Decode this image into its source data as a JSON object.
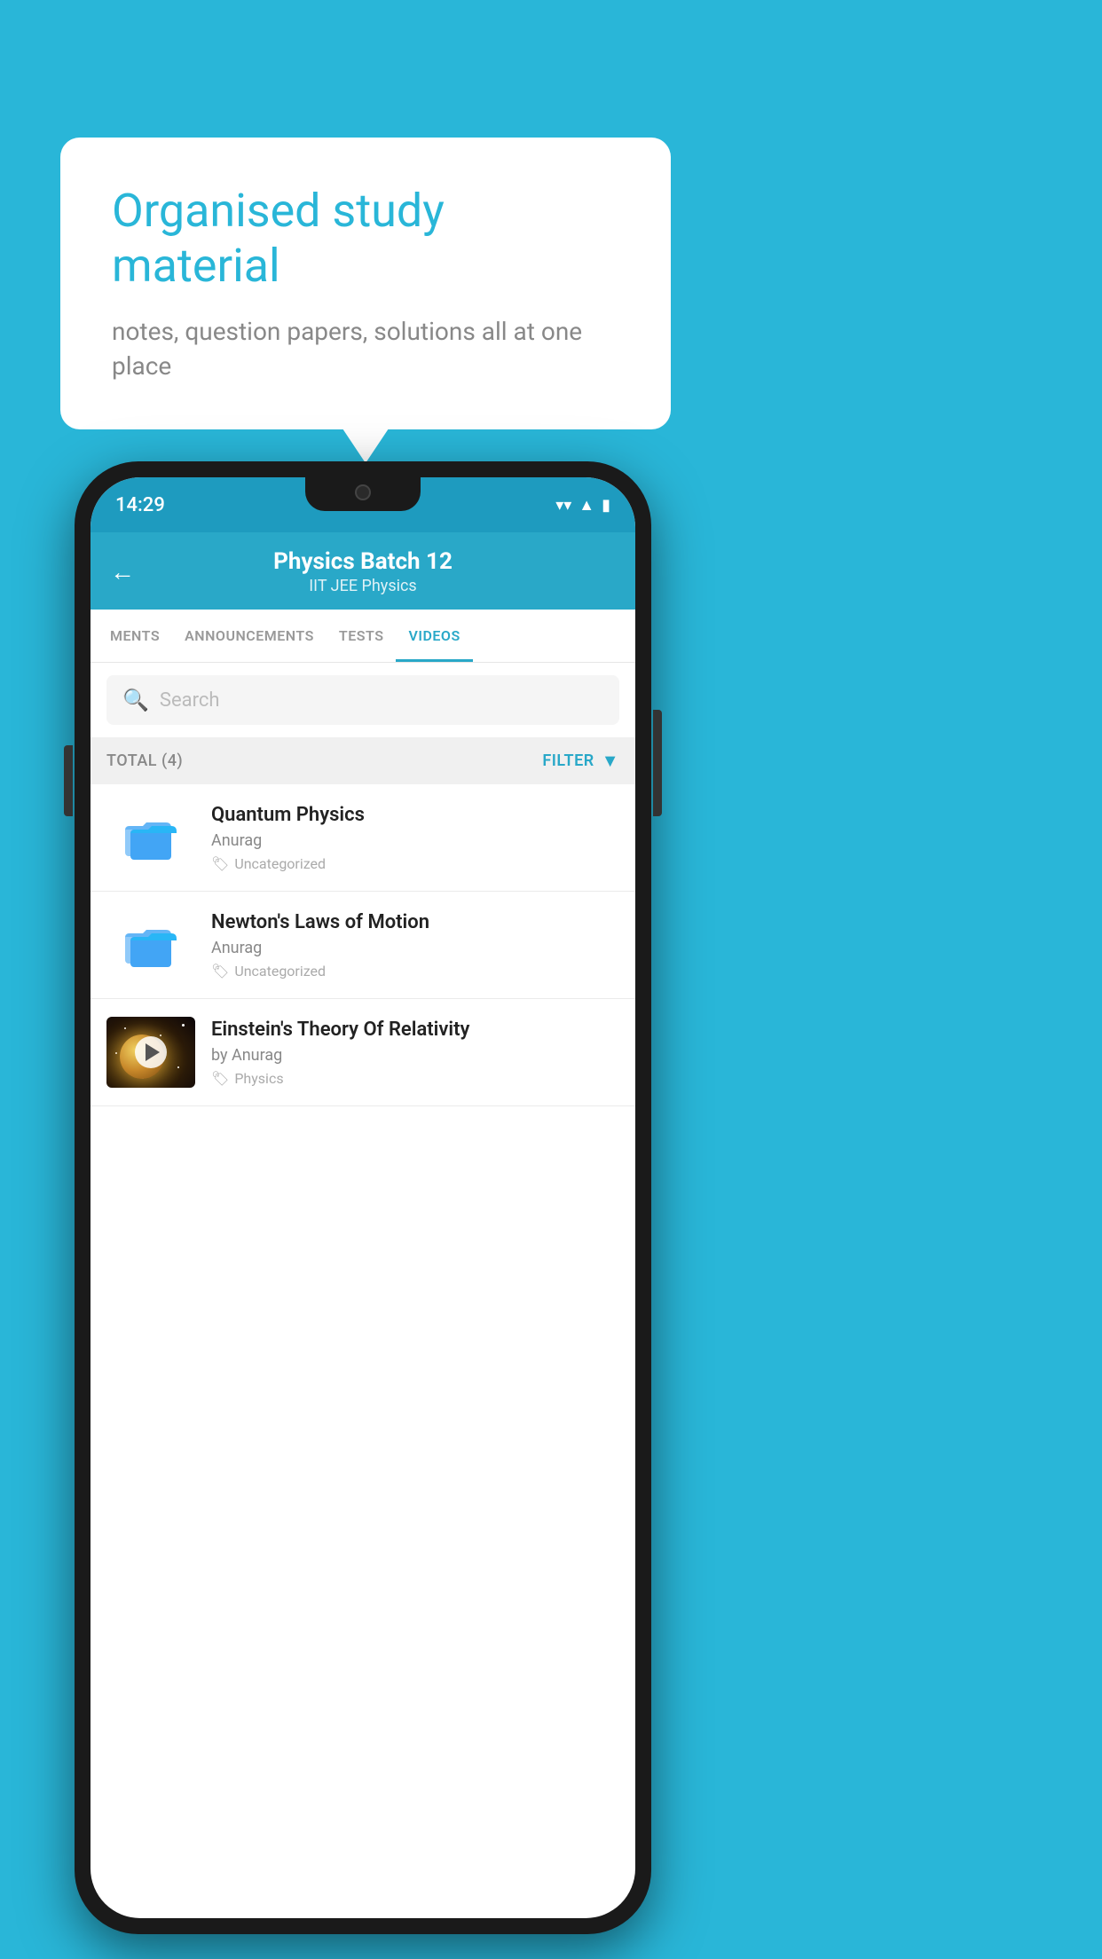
{
  "background_color": "#29b6d8",
  "speech_bubble": {
    "title": "Organised study material",
    "subtitle": "notes, question papers, solutions all at one place"
  },
  "status_bar": {
    "time": "14:29",
    "wifi_icon": "wifi",
    "signal_icon": "signal",
    "battery_icon": "battery"
  },
  "app_header": {
    "back_label": "←",
    "title": "Physics Batch 12",
    "subtitle": "IIT JEE   Physics"
  },
  "tabs": [
    {
      "label": "MENTS",
      "active": false
    },
    {
      "label": "ANNOUNCEMENTS",
      "active": false
    },
    {
      "label": "TESTS",
      "active": false
    },
    {
      "label": "VIDEOS",
      "active": true
    }
  ],
  "search": {
    "placeholder": "Search"
  },
  "filter_bar": {
    "total_label": "TOTAL (4)",
    "filter_label": "FILTER"
  },
  "videos": [
    {
      "title": "Quantum Physics",
      "author": "Anurag",
      "tag": "Uncategorized",
      "has_thumb": false
    },
    {
      "title": "Newton's Laws of Motion",
      "author": "Anurag",
      "tag": "Uncategorized",
      "has_thumb": false
    },
    {
      "title": "Einstein's Theory Of Relativity",
      "author": "by Anurag",
      "tag": "Physics",
      "has_thumb": true
    }
  ]
}
